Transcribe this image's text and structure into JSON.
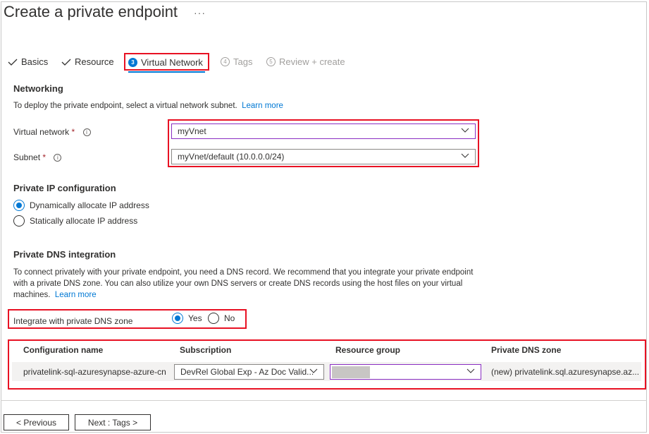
{
  "header": {
    "title": "Create a private endpoint",
    "more_label": "···"
  },
  "tabs": [
    {
      "label": "Basics",
      "state": "completed",
      "icon": "checkmark-icon"
    },
    {
      "label": "Resource",
      "state": "completed",
      "icon": "checkmark-icon"
    },
    {
      "label": "Virtual Network",
      "state": "active",
      "step": "3"
    },
    {
      "label": "Tags",
      "state": "disabled",
      "step": "4"
    },
    {
      "label": "Review + create",
      "state": "disabled",
      "step": "5"
    }
  ],
  "networking": {
    "heading": "Networking",
    "description": "To deploy the private endpoint, select a virtual network subnet.",
    "learn_more": "Learn more",
    "virtual_network": {
      "label": "Virtual network",
      "required": "*",
      "value": "myVnet"
    },
    "subnet": {
      "label": "Subnet",
      "required": "*",
      "value": "myVnet/default (10.0.0.0/24)"
    }
  },
  "ip_config": {
    "heading": "Private IP configuration",
    "options": [
      {
        "label": "Dynamically allocate IP address",
        "selected": true
      },
      {
        "label": "Statically allocate IP address",
        "selected": false
      }
    ]
  },
  "dns": {
    "heading": "Private DNS integration",
    "description": "To connect privately with your private endpoint, you need a DNS record. We recommend that you integrate your private endpoint with a private DNS zone. You can also utilize your own DNS servers or create DNS records using the host files on your virtual machines.",
    "learn_more": "Learn more",
    "integrate_label": "Integrate with private DNS zone",
    "yes_label": "Yes",
    "no_label": "No",
    "integrate_selected": "Yes",
    "table": {
      "columns": [
        "Configuration name",
        "Subscription",
        "Resource group",
        "Private DNS zone"
      ],
      "rows": [
        {
          "configuration_name": "privatelink-sql-azuresynapse-azure-cn",
          "subscription": "DevRel Global Exp - Az Doc Valid...",
          "resource_group": "",
          "private_dns_zone": "(new) privatelink.sql.azuresynapse.az..."
        }
      ]
    }
  },
  "footer": {
    "previous_label": "< Previous",
    "next_label": "Next : Tags >"
  },
  "colors": {
    "accent": "#0078d4",
    "highlight_box": "#e81123",
    "focus_border": "#8a2ec2"
  }
}
